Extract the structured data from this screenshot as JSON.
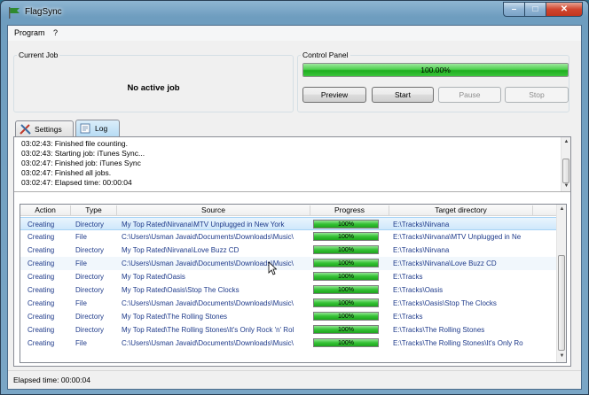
{
  "window": {
    "title": "FlagSync"
  },
  "menu": {
    "items": [
      "Program",
      "?"
    ]
  },
  "current_job": {
    "legend": "Current Job",
    "text": "No active job"
  },
  "control_panel": {
    "legend": "Control Panel",
    "progress_value": 1.0,
    "progress_text": "100.00%",
    "buttons": {
      "preview": "Preview",
      "start": "Start",
      "pause": "Pause",
      "stop": "Stop"
    }
  },
  "tabs": {
    "settings": "Settings",
    "log": "Log"
  },
  "log": {
    "lines": [
      "03:02:43: Finished file counting.",
      "03:02:43: Starting job: iTunes Sync...",
      "03:02:47: Finished job: iTunes Sync",
      "03:02:47: Finished all jobs.",
      "03:02:47: Elapsed time: 00:00:04"
    ]
  },
  "table": {
    "columns": [
      "Action",
      "Type",
      "Source",
      "Progress",
      "Target directory"
    ],
    "rows": [
      {
        "action": "Creating",
        "type": "Directory",
        "source": "My Top Rated\\Nirvana\\MTV Unplugged in New York",
        "progress": "100%",
        "progress_value": 1.0,
        "target": "E:\\Tracks\\Nirvana"
      },
      {
        "action": "Creating",
        "type": "File",
        "source": "C:\\Users\\Usman Javaid\\Documents\\Downloads\\Music\\",
        "progress": "100%",
        "progress_value": 1.0,
        "target": "E:\\Tracks\\Nirvana\\MTV Unplugged in Ne"
      },
      {
        "action": "Creating",
        "type": "Directory",
        "source": "My Top Rated\\Nirvana\\Love Buzz CD",
        "progress": "100%",
        "progress_value": 1.0,
        "target": "E:\\Tracks\\Nirvana"
      },
      {
        "action": "Creating",
        "type": "File",
        "source": "C:\\Users\\Usman Javaid\\Documents\\Downloads\\Music\\",
        "progress": "100%",
        "progress_value": 1.0,
        "target": "E:\\Tracks\\Nirvana\\Love Buzz CD"
      },
      {
        "action": "Creating",
        "type": "Directory",
        "source": "My Top Rated\\Oasis",
        "progress": "100%",
        "progress_value": 1.0,
        "target": "E:\\Tracks"
      },
      {
        "action": "Creating",
        "type": "Directory",
        "source": "My Top Rated\\Oasis\\Stop The Clocks",
        "progress": "100%",
        "progress_value": 1.0,
        "target": "E:\\Tracks\\Oasis"
      },
      {
        "action": "Creating",
        "type": "File",
        "source": "C:\\Users\\Usman Javaid\\Documents\\Downloads\\Music\\",
        "progress": "100%",
        "progress_value": 1.0,
        "target": "E:\\Tracks\\Oasis\\Stop The Clocks"
      },
      {
        "action": "Creating",
        "type": "Directory",
        "source": "My Top Rated\\The Rolling Stones",
        "progress": "100%",
        "progress_value": 1.0,
        "target": "E:\\Tracks"
      },
      {
        "action": "Creating",
        "type": "Directory",
        "source": "My Top Rated\\The Rolling Stones\\It's Only Rock 'n' Rol",
        "progress": "100%",
        "progress_value": 1.0,
        "target": "E:\\Tracks\\The Rolling Stones"
      },
      {
        "action": "Creating",
        "type": "File",
        "source": "C:\\Users\\Usman Javaid\\Documents\\Downloads\\Music\\",
        "progress": "100%",
        "progress_value": 1.0,
        "target": "E:\\Tracks\\The Rolling Stones\\It's Only Ro"
      }
    ]
  },
  "status": {
    "text": "Elapsed time: 00:00:04"
  },
  "colors": {
    "accent": "#3bc63b",
    "link_text": "#1e3a8a",
    "selection": "#cfe8fb"
  }
}
